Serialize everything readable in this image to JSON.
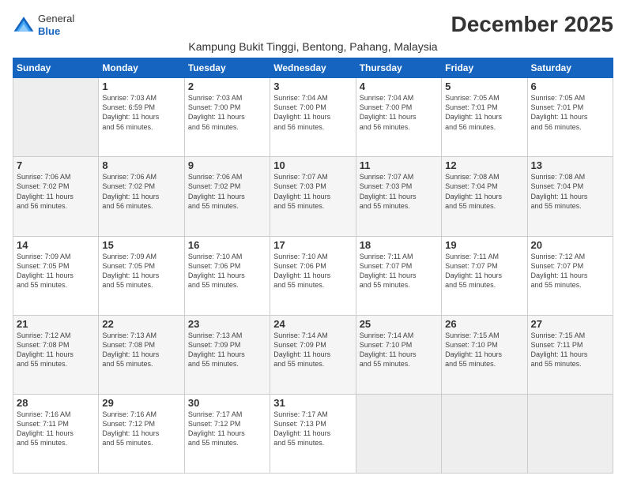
{
  "logo": {
    "general": "General",
    "blue": "Blue"
  },
  "title": "December 2025",
  "subtitle": "Kampung Bukit Tinggi, Bentong, Pahang, Malaysia",
  "days_header": [
    "Sunday",
    "Monday",
    "Tuesday",
    "Wednesday",
    "Thursday",
    "Friday",
    "Saturday"
  ],
  "weeks": [
    [
      {
        "day": "",
        "info": ""
      },
      {
        "day": "1",
        "info": "Sunrise: 7:03 AM\nSunset: 6:59 PM\nDaylight: 11 hours\nand 56 minutes."
      },
      {
        "day": "2",
        "info": "Sunrise: 7:03 AM\nSunset: 7:00 PM\nDaylight: 11 hours\nand 56 minutes."
      },
      {
        "day": "3",
        "info": "Sunrise: 7:04 AM\nSunset: 7:00 PM\nDaylight: 11 hours\nand 56 minutes."
      },
      {
        "day": "4",
        "info": "Sunrise: 7:04 AM\nSunset: 7:00 PM\nDaylight: 11 hours\nand 56 minutes."
      },
      {
        "day": "5",
        "info": "Sunrise: 7:05 AM\nSunset: 7:01 PM\nDaylight: 11 hours\nand 56 minutes."
      },
      {
        "day": "6",
        "info": "Sunrise: 7:05 AM\nSunset: 7:01 PM\nDaylight: 11 hours\nand 56 minutes."
      }
    ],
    [
      {
        "day": "7",
        "info": "Sunrise: 7:06 AM\nSunset: 7:02 PM\nDaylight: 11 hours\nand 56 minutes."
      },
      {
        "day": "8",
        "info": "Sunrise: 7:06 AM\nSunset: 7:02 PM\nDaylight: 11 hours\nand 56 minutes."
      },
      {
        "day": "9",
        "info": "Sunrise: 7:06 AM\nSunset: 7:02 PM\nDaylight: 11 hours\nand 55 minutes."
      },
      {
        "day": "10",
        "info": "Sunrise: 7:07 AM\nSunset: 7:03 PM\nDaylight: 11 hours\nand 55 minutes."
      },
      {
        "day": "11",
        "info": "Sunrise: 7:07 AM\nSunset: 7:03 PM\nDaylight: 11 hours\nand 55 minutes."
      },
      {
        "day": "12",
        "info": "Sunrise: 7:08 AM\nSunset: 7:04 PM\nDaylight: 11 hours\nand 55 minutes."
      },
      {
        "day": "13",
        "info": "Sunrise: 7:08 AM\nSunset: 7:04 PM\nDaylight: 11 hours\nand 55 minutes."
      }
    ],
    [
      {
        "day": "14",
        "info": "Sunrise: 7:09 AM\nSunset: 7:05 PM\nDaylight: 11 hours\nand 55 minutes."
      },
      {
        "day": "15",
        "info": "Sunrise: 7:09 AM\nSunset: 7:05 PM\nDaylight: 11 hours\nand 55 minutes."
      },
      {
        "day": "16",
        "info": "Sunrise: 7:10 AM\nSunset: 7:06 PM\nDaylight: 11 hours\nand 55 minutes."
      },
      {
        "day": "17",
        "info": "Sunrise: 7:10 AM\nSunset: 7:06 PM\nDaylight: 11 hours\nand 55 minutes."
      },
      {
        "day": "18",
        "info": "Sunrise: 7:11 AM\nSunset: 7:07 PM\nDaylight: 11 hours\nand 55 minutes."
      },
      {
        "day": "19",
        "info": "Sunrise: 7:11 AM\nSunset: 7:07 PM\nDaylight: 11 hours\nand 55 minutes."
      },
      {
        "day": "20",
        "info": "Sunrise: 7:12 AM\nSunset: 7:07 PM\nDaylight: 11 hours\nand 55 minutes."
      }
    ],
    [
      {
        "day": "21",
        "info": "Sunrise: 7:12 AM\nSunset: 7:08 PM\nDaylight: 11 hours\nand 55 minutes."
      },
      {
        "day": "22",
        "info": "Sunrise: 7:13 AM\nSunset: 7:08 PM\nDaylight: 11 hours\nand 55 minutes."
      },
      {
        "day": "23",
        "info": "Sunrise: 7:13 AM\nSunset: 7:09 PM\nDaylight: 11 hours\nand 55 minutes."
      },
      {
        "day": "24",
        "info": "Sunrise: 7:14 AM\nSunset: 7:09 PM\nDaylight: 11 hours\nand 55 minutes."
      },
      {
        "day": "25",
        "info": "Sunrise: 7:14 AM\nSunset: 7:10 PM\nDaylight: 11 hours\nand 55 minutes."
      },
      {
        "day": "26",
        "info": "Sunrise: 7:15 AM\nSunset: 7:10 PM\nDaylight: 11 hours\nand 55 minutes."
      },
      {
        "day": "27",
        "info": "Sunrise: 7:15 AM\nSunset: 7:11 PM\nDaylight: 11 hours\nand 55 minutes."
      }
    ],
    [
      {
        "day": "28",
        "info": "Sunrise: 7:16 AM\nSunset: 7:11 PM\nDaylight: 11 hours\nand 55 minutes."
      },
      {
        "day": "29",
        "info": "Sunrise: 7:16 AM\nSunset: 7:12 PM\nDaylight: 11 hours\nand 55 minutes."
      },
      {
        "day": "30",
        "info": "Sunrise: 7:17 AM\nSunset: 7:12 PM\nDaylight: 11 hours\nand 55 minutes."
      },
      {
        "day": "31",
        "info": "Sunrise: 7:17 AM\nSunset: 7:13 PM\nDaylight: 11 hours\nand 55 minutes."
      },
      {
        "day": "",
        "info": ""
      },
      {
        "day": "",
        "info": ""
      },
      {
        "day": "",
        "info": ""
      }
    ]
  ]
}
